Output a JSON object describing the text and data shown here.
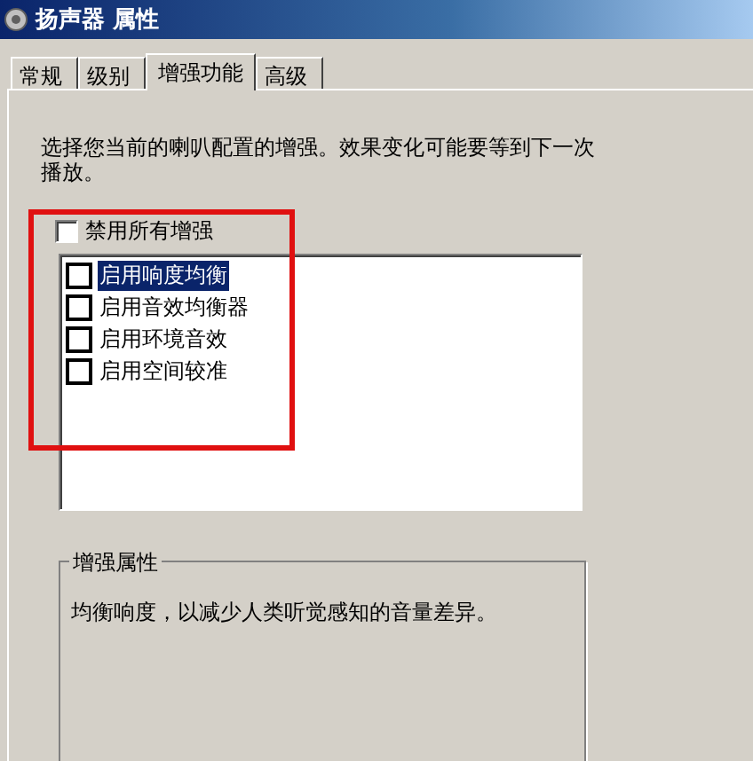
{
  "window": {
    "title": "扬声器 属性"
  },
  "tabs": [
    {
      "label": "常规",
      "selected": false
    },
    {
      "label": "级别",
      "selected": false
    },
    {
      "label": "增强功能",
      "selected": true
    },
    {
      "label": "高级",
      "selected": false
    }
  ],
  "description": "选择您当前的喇叭配置的增强。效果变化可能要等到下一次播放。",
  "disable_all": {
    "label": "禁用所有增强",
    "checked": false
  },
  "enhancements": [
    {
      "label": "启用响度均衡",
      "checked": false,
      "selected": true
    },
    {
      "label": "启用音效均衡器",
      "checked": false,
      "selected": false
    },
    {
      "label": "启用环境音效",
      "checked": false,
      "selected": false
    },
    {
      "label": "启用空间较准",
      "checked": false,
      "selected": false
    }
  ],
  "properties_group": {
    "title": "增强属性",
    "text": "均衡响度，以减少人类听觉感知的音量差异。"
  }
}
